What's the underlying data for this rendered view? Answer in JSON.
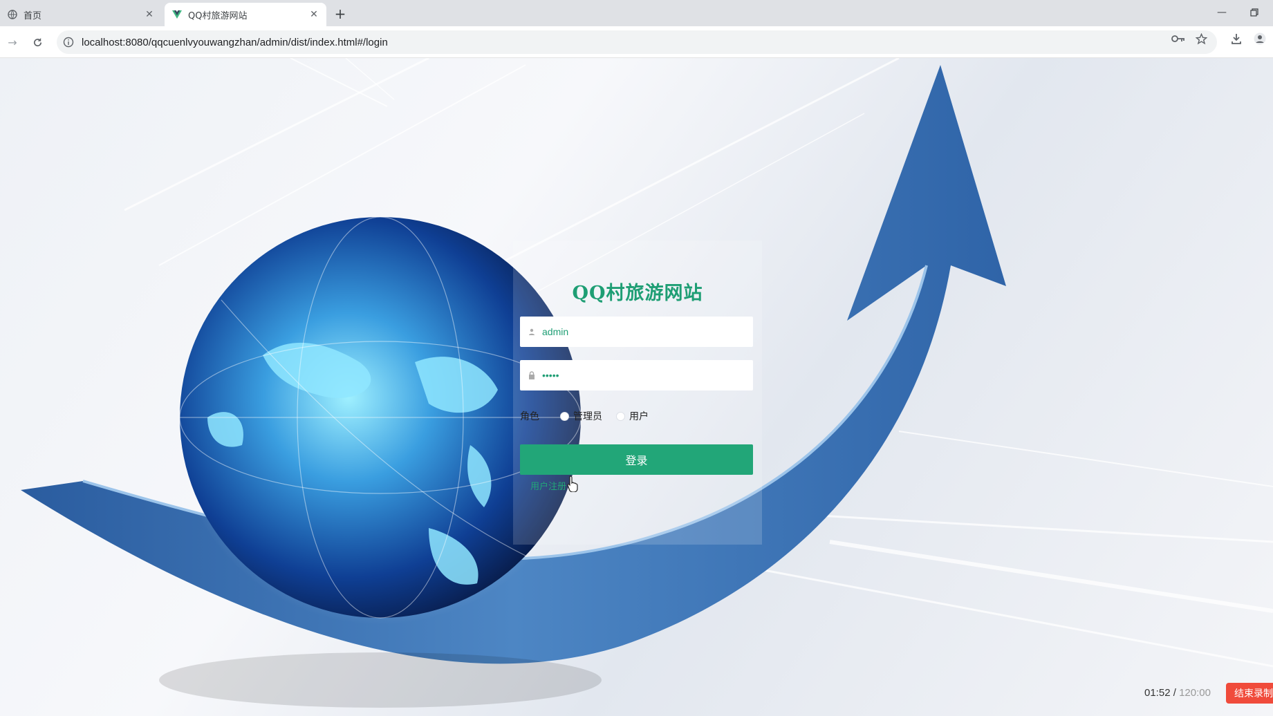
{
  "browser": {
    "tabs": [
      {
        "title": "首页",
        "icon": "globe-icon",
        "active": false
      },
      {
        "title": "QQ村旅游网站",
        "icon": "vue-logo-icon",
        "active": true
      }
    ],
    "url": "localhost:8080/qqcuenlvyouwangzhan/admin/dist/index.html#/login"
  },
  "login": {
    "site_title": "QQ村旅游网站",
    "username_value": "admin",
    "password_value": "•••••",
    "role_label": "角色",
    "roles": [
      "管理员",
      "用户"
    ],
    "login_button": "登录",
    "register_link": "用户注册"
  },
  "recorder": {
    "elapsed": "01:52",
    "separator": "/",
    "total": "120:00",
    "stop_label": "结束录制"
  },
  "colors": {
    "accent": "#22a678",
    "title": "#1e9e74",
    "stop": "#f04b3b"
  }
}
